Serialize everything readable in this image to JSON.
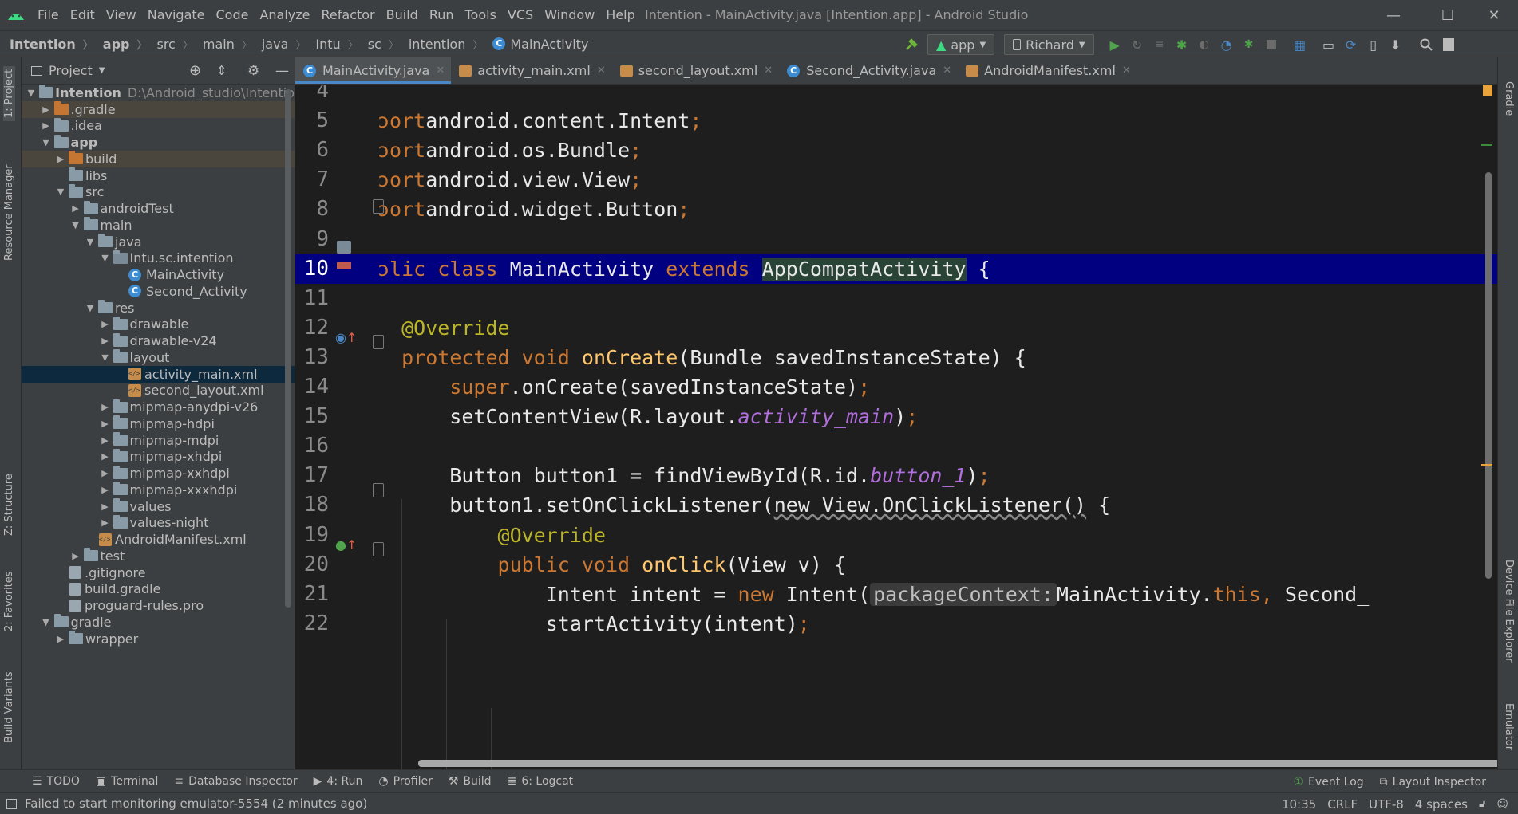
{
  "menubar": {
    "items": [
      "File",
      "Edit",
      "View",
      "Navigate",
      "Code",
      "Analyze",
      "Refactor",
      "Build",
      "Run",
      "Tools",
      "VCS",
      "Window",
      "Help"
    ],
    "title": "Intention - MainActivity.java [Intention.app] - Android Studio",
    "minimize": "—",
    "maximize": "☐",
    "close": "✕"
  },
  "breadcrumb": [
    "Intention",
    "app",
    "src",
    "main",
    "java",
    "Intu",
    "sc",
    "intention",
    "MainActivity"
  ],
  "toolbar": {
    "module": "app",
    "device": "Richard"
  },
  "left_stripe": {
    "project": "1: Project",
    "resource_manager": "Resource Manager",
    "structure": "Z: Structure",
    "favorites": "2: Favorites",
    "build_variants": "Build Variants"
  },
  "right_stripe": {
    "gradle": "Gradle",
    "device_file_explorer": "Device File Explorer",
    "emulator": "Emulator"
  },
  "project_panel": {
    "title": "Project",
    "root_name": "Intention",
    "root_path": "D:\\Android_studio\\Intentio",
    "items": [
      {
        "label": ".gradle",
        "depth": 1,
        "arrow": "▶",
        "icon": "folder-orange",
        "hl": true
      },
      {
        "label": ".idea",
        "depth": 1,
        "arrow": "▶",
        "icon": "folder"
      },
      {
        "label": "app",
        "depth": 1,
        "arrow": "▼",
        "icon": "folder",
        "bold": true
      },
      {
        "label": "build",
        "depth": 2,
        "arrow": "▶",
        "icon": "folder-orange",
        "hl": true
      },
      {
        "label": "libs",
        "depth": 2,
        "arrow": "",
        "icon": "folder"
      },
      {
        "label": "src",
        "depth": 2,
        "arrow": "▼",
        "icon": "folder"
      },
      {
        "label": "androidTest",
        "depth": 3,
        "arrow": "▶",
        "icon": "folder"
      },
      {
        "label": "main",
        "depth": 3,
        "arrow": "▼",
        "icon": "folder"
      },
      {
        "label": "java",
        "depth": 4,
        "arrow": "▼",
        "icon": "folder"
      },
      {
        "label": "Intu.sc.intention",
        "depth": 5,
        "arrow": "▼",
        "icon": "package"
      },
      {
        "label": "MainActivity",
        "depth": 6,
        "arrow": "",
        "icon": "class"
      },
      {
        "label": "Second_Activity",
        "depth": 6,
        "arrow": "",
        "icon": "class"
      },
      {
        "label": "res",
        "depth": 4,
        "arrow": "▼",
        "icon": "folder"
      },
      {
        "label": "drawable",
        "depth": 5,
        "arrow": "▶",
        "icon": "folder"
      },
      {
        "label": "drawable-v24",
        "depth": 5,
        "arrow": "▶",
        "icon": "folder"
      },
      {
        "label": "layout",
        "depth": 5,
        "arrow": "▼",
        "icon": "folder"
      },
      {
        "label": "activity_main.xml",
        "depth": 6,
        "arrow": "",
        "icon": "xml",
        "sel": true
      },
      {
        "label": "second_layout.xml",
        "depth": 6,
        "arrow": "",
        "icon": "xml"
      },
      {
        "label": "mipmap-anydpi-v26",
        "depth": 5,
        "arrow": "▶",
        "icon": "folder"
      },
      {
        "label": "mipmap-hdpi",
        "depth": 5,
        "arrow": "▶",
        "icon": "folder"
      },
      {
        "label": "mipmap-mdpi",
        "depth": 5,
        "arrow": "▶",
        "icon": "folder"
      },
      {
        "label": "mipmap-xhdpi",
        "depth": 5,
        "arrow": "▶",
        "icon": "folder"
      },
      {
        "label": "mipmap-xxhdpi",
        "depth": 5,
        "arrow": "▶",
        "icon": "folder"
      },
      {
        "label": "mipmap-xxxhdpi",
        "depth": 5,
        "arrow": "▶",
        "icon": "folder"
      },
      {
        "label": "values",
        "depth": 5,
        "arrow": "▶",
        "icon": "folder"
      },
      {
        "label": "values-night",
        "depth": 5,
        "arrow": "▶",
        "icon": "folder"
      },
      {
        "label": "AndroidManifest.xml",
        "depth": 4,
        "arrow": "",
        "icon": "xml"
      },
      {
        "label": "test",
        "depth": 3,
        "arrow": "▶",
        "icon": "folder"
      },
      {
        "label": ".gitignore",
        "depth": 2,
        "arrow": "",
        "icon": "file"
      },
      {
        "label": "build.gradle",
        "depth": 2,
        "arrow": "",
        "icon": "file"
      },
      {
        "label": "proguard-rules.pro",
        "depth": 2,
        "arrow": "",
        "icon": "file"
      },
      {
        "label": "gradle",
        "depth": 1,
        "arrow": "▼",
        "icon": "folder"
      },
      {
        "label": "wrapper",
        "depth": 2,
        "arrow": "▶",
        "icon": "folder"
      }
    ]
  },
  "tabs": [
    {
      "label": "MainActivity.java",
      "icon": "class",
      "active": true
    },
    {
      "label": "activity_main.xml",
      "icon": "xml"
    },
    {
      "label": "second_layout.xml",
      "icon": "xml"
    },
    {
      "label": "Second_Activity.java",
      "icon": "class"
    },
    {
      "label": "AndroidManifest.xml",
      "icon": "xml"
    }
  ],
  "editor": {
    "current_line": "10",
    "lines": [
      {
        "n": "4",
        "tokens": []
      },
      {
        "n": "5",
        "tokens": [
          [
            "kw",
            "ɔort"
          ],
          [
            "",
            "android.content.Intent"
          ],
          [
            "semi",
            ";"
          ]
        ]
      },
      {
        "n": "6",
        "tokens": [
          [
            "kw",
            "ɔort"
          ],
          [
            "",
            "android.os.Bundle"
          ],
          [
            "semi",
            ";"
          ]
        ]
      },
      {
        "n": "7",
        "tokens": [
          [
            "kw",
            "ɔort"
          ],
          [
            "",
            "android.view.View"
          ],
          [
            "semi",
            ";"
          ]
        ]
      },
      {
        "n": "8",
        "tokens": [
          [
            "kw",
            "ɔort"
          ],
          [
            "",
            "android.widget.Button"
          ],
          [
            "semi",
            ";"
          ]
        ]
      },
      {
        "n": "9",
        "tokens": []
      },
      {
        "n": "10",
        "tokens": [
          [
            "kw",
            "ɔlic class "
          ],
          [
            "",
            "MainActivity "
          ],
          [
            "kw",
            "extends "
          ],
          [
            "hlgreen",
            "AppCompatActivity"
          ],
          [
            "",
            " {"
          ]
        ]
      },
      {
        "n": "11",
        "tokens": []
      },
      {
        "n": "12",
        "tokens": [
          [
            "",
            "  "
          ],
          [
            "ann",
            "@Override"
          ]
        ]
      },
      {
        "n": "13",
        "tokens": [
          [
            "",
            "  "
          ],
          [
            "kw",
            "protected void "
          ],
          [
            "fn",
            "onCreate"
          ],
          [
            "",
            "(Bundle savedInstanceState) {"
          ]
        ]
      },
      {
        "n": "14",
        "tokens": [
          [
            "",
            "      "
          ],
          [
            "kw",
            "super"
          ],
          [
            "",
            ".onCreate(savedInstanceState)"
          ],
          [
            "semi",
            ";"
          ]
        ]
      },
      {
        "n": "15",
        "tokens": [
          [
            "",
            "      setContentView(R.layout."
          ],
          [
            "fld",
            "activity_main"
          ],
          [
            "",
            ")"
          ],
          [
            "semi",
            ";"
          ]
        ]
      },
      {
        "n": "16",
        "tokens": []
      },
      {
        "n": "17",
        "tokens": [
          [
            "",
            "      Button button1 = findViewById(R.id."
          ],
          [
            "fld",
            "button_1"
          ],
          [
            "",
            ")"
          ],
          [
            "semi",
            ";"
          ]
        ]
      },
      {
        "n": "18",
        "tokens": [
          [
            "",
            "      button1.setOnClickListener("
          ],
          [
            "squig",
            "new View.OnClickListener()"
          ],
          [
            "",
            " {"
          ]
        ]
      },
      {
        "n": "19",
        "tokens": [
          [
            "",
            "          "
          ],
          [
            "ann",
            "@Override"
          ]
        ]
      },
      {
        "n": "20",
        "tokens": [
          [
            "",
            "          "
          ],
          [
            "kw",
            "public void "
          ],
          [
            "fn",
            "onClick"
          ],
          [
            "",
            "(View v) {"
          ]
        ]
      },
      {
        "n": "21",
        "tokens": [
          [
            "",
            "              Intent intent = "
          ],
          [
            "kw",
            "new "
          ],
          [
            "",
            "Intent("
          ],
          [
            "hint-box",
            "packageContext:"
          ],
          [
            "",
            "MainActivity."
          ],
          [
            "kw",
            "this"
          ],
          [
            "semi",
            ","
          ],
          [
            "",
            " Second_"
          ]
        ]
      },
      {
        "n": "22",
        "tokens": [
          [
            "",
            "              startActivity(intent)"
          ],
          [
            "semi",
            ";"
          ]
        ]
      }
    ]
  },
  "toolwindows_left": [
    {
      "label": "TODO",
      "icon": "☰"
    },
    {
      "label": "Terminal",
      "icon": "▣"
    },
    {
      "label": "Database Inspector",
      "icon": "≡"
    },
    {
      "label": "4: Run",
      "icon": "▶"
    },
    {
      "label": "Profiler",
      "icon": "◔"
    },
    {
      "label": "Build",
      "icon": "⚒"
    },
    {
      "label": "6: Logcat",
      "icon": "≣"
    }
  ],
  "toolwindows_right": [
    {
      "label": "Event Log",
      "icon": "①"
    },
    {
      "label": "Layout Inspector",
      "icon": "⧉"
    }
  ],
  "statusbar": {
    "message": "Failed to start monitoring emulator-5554 (2 minutes ago)",
    "position": "10:35",
    "line_sep": "CRLF",
    "encoding": "UTF-8",
    "indent": "4 spaces"
  },
  "colors": {
    "current_line": "#000080",
    "keyword": "#cc7832",
    "annotation": "#bbb529",
    "method": "#ffc66d",
    "field": "#b06fdb"
  }
}
